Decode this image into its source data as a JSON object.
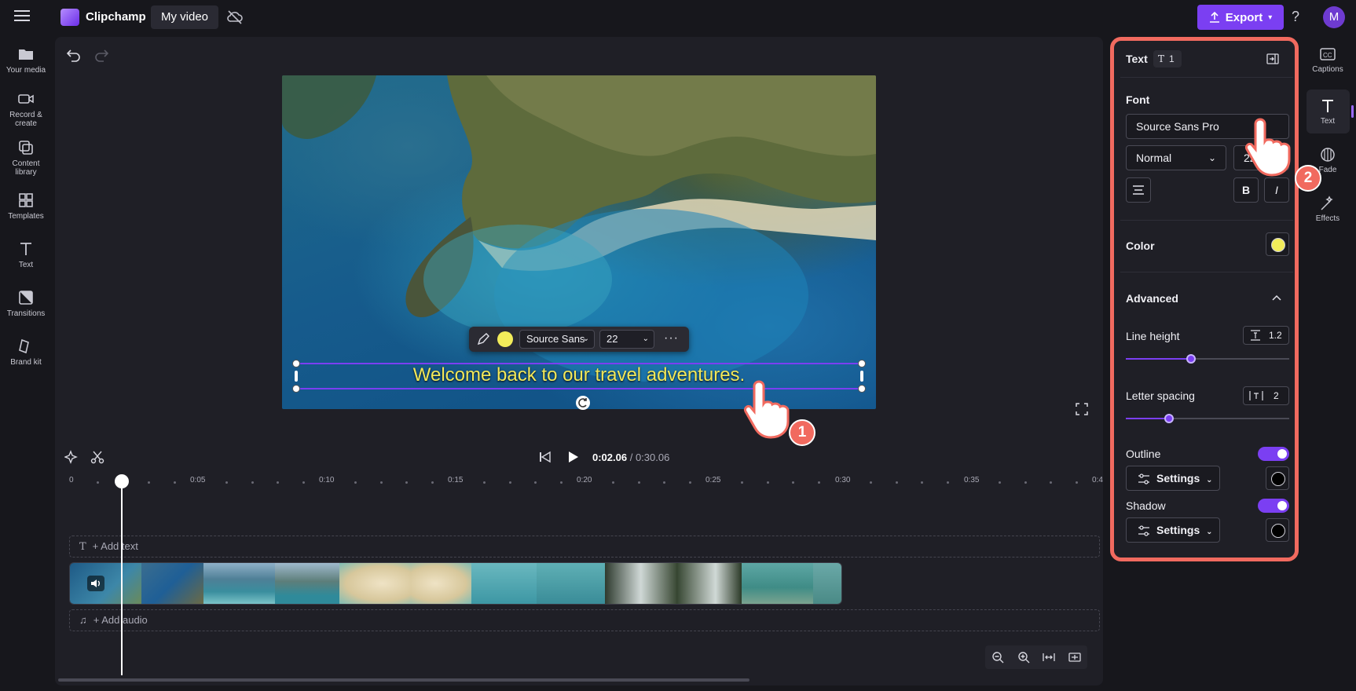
{
  "app": {
    "brand": "Clipchamp",
    "project_name": "My video",
    "export_label": "Export",
    "help": "?",
    "avatar_initial": "M"
  },
  "left_nav": [
    {
      "label": "Your media",
      "icon": "folder-icon"
    },
    {
      "label": "Record & create",
      "icon": "camera-icon"
    },
    {
      "label": "Content library",
      "icon": "library-icon"
    },
    {
      "label": "Templates",
      "icon": "templates-icon"
    },
    {
      "label": "Text",
      "icon": "text-icon"
    },
    {
      "label": "Transitions",
      "icon": "transitions-icon"
    },
    {
      "label": "Brand kit",
      "icon": "brand-kit-icon"
    }
  ],
  "preview": {
    "caption": "Welcome back to our travel adventures.",
    "toolbar": {
      "font": "Source Sans",
      "size": "22",
      "color": "#f2ec5a"
    }
  },
  "playback": {
    "current": "0:02.06",
    "duration": "/ 0:30.06"
  },
  "timeline": {
    "ticks": [
      "0",
      "0:05",
      "0:10",
      "0:15",
      "0:20",
      "0:25",
      "0:30",
      "0:35",
      "0:4"
    ],
    "add_text": "+ Add text",
    "add_audio": "+ Add audio"
  },
  "properties": {
    "header": "Text",
    "layer_count": "1",
    "font_section": "Font",
    "font_value": "Source Sans Pro",
    "weight_value": "Normal",
    "size_value": "22",
    "bold": "B",
    "italic": "I",
    "color_label": "Color",
    "color_value": "#f2ec5a",
    "advanced_label": "Advanced",
    "line_height_label": "Line height",
    "line_height_value": "1.2",
    "line_height_level": 0.4,
    "letter_spacing_label": "Letter spacing",
    "letter_spacing_value": "2",
    "letter_spacing_level": 0.27,
    "outline_label": "Outline",
    "outline_settings": "Settings",
    "outline_enabled": true,
    "shadow_label": "Shadow",
    "shadow_settings": "Settings",
    "shadow_enabled": true
  },
  "right_rail": [
    {
      "label": "Captions",
      "icon": "captions-icon"
    },
    {
      "label": "Text",
      "icon": "text-icon"
    },
    {
      "label": "Fade",
      "icon": "fade-icon"
    },
    {
      "label": "Effects",
      "icon": "effects-icon"
    }
  ],
  "annotations": {
    "step1": "1",
    "step2": "2"
  },
  "colors": {
    "accent": "#7b3ff2",
    "highlight": "#f16a5f",
    "caption": "#f2e85a"
  }
}
